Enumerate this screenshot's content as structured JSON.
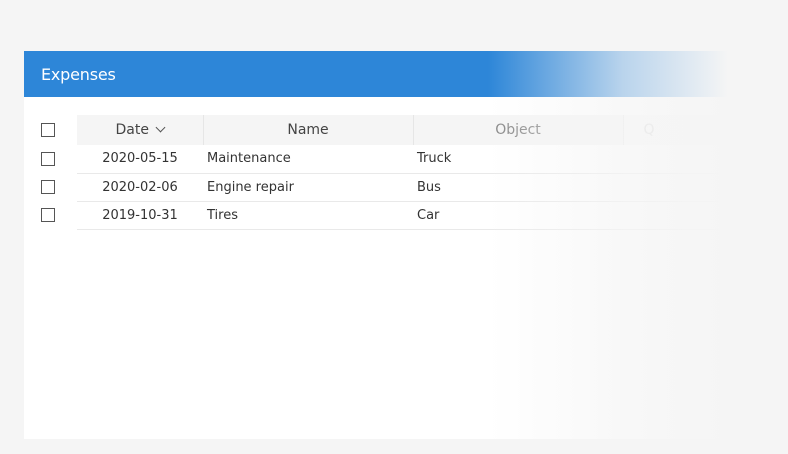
{
  "panel": {
    "title": "Expenses",
    "accent_color": "#2d86d8"
  },
  "table": {
    "columns": {
      "date": "Date",
      "name": "Name",
      "object": "Object",
      "extra": "Q"
    },
    "sort_icon": "chevron-down-icon",
    "rows": [
      {
        "date": "2020-05-15",
        "name": "Maintenance",
        "object": "Truck"
      },
      {
        "date": "2020-02-06",
        "name": "Engine repair",
        "object": "Bus"
      },
      {
        "date": "2019-10-31",
        "name": "Tires",
        "object": "Car"
      }
    ]
  }
}
